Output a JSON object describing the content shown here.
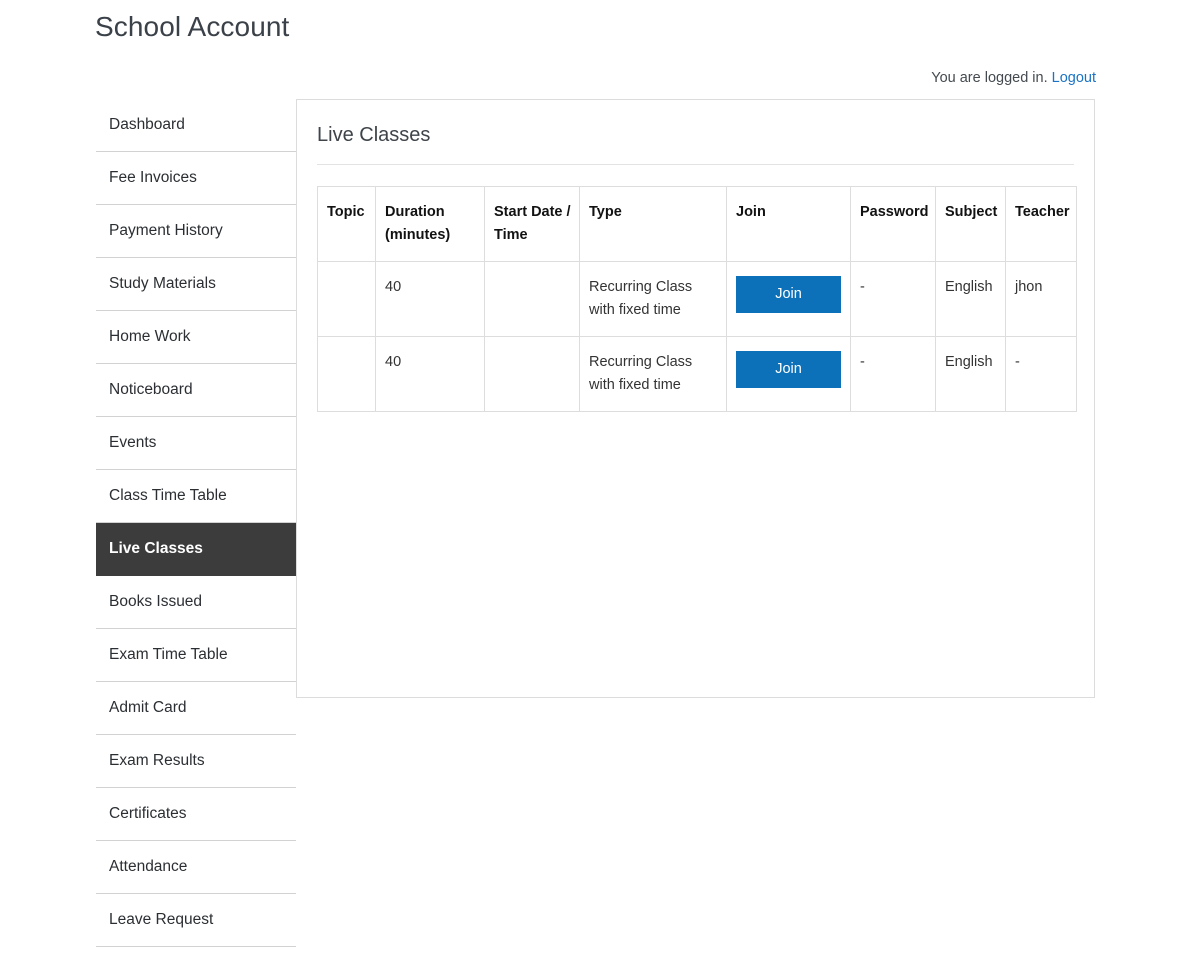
{
  "header": {
    "title": "School Account",
    "status_text": "You are logged in.",
    "logout_label": "Logout"
  },
  "sidebar": {
    "items": [
      {
        "label": "Dashboard",
        "active": false
      },
      {
        "label": "Fee Invoices",
        "active": false
      },
      {
        "label": "Payment History",
        "active": false
      },
      {
        "label": "Study Materials",
        "active": false
      },
      {
        "label": "Home Work",
        "active": false
      },
      {
        "label": "Noticeboard",
        "active": false
      },
      {
        "label": "Events",
        "active": false
      },
      {
        "label": "Class Time Table",
        "active": false
      },
      {
        "label": "Live Classes",
        "active": true
      },
      {
        "label": "Books Issued",
        "active": false
      },
      {
        "label": "Exam Time Table",
        "active": false
      },
      {
        "label": "Admit Card",
        "active": false
      },
      {
        "label": "Exam Results",
        "active": false
      },
      {
        "label": "Certificates",
        "active": false
      },
      {
        "label": "Attendance",
        "active": false
      },
      {
        "label": "Leave Request",
        "active": false
      }
    ]
  },
  "panel": {
    "heading": "Live Classes",
    "table": {
      "columns": [
        {
          "key": "topic",
          "label": "Topic"
        },
        {
          "key": "duration",
          "label": "Duration (minutes)"
        },
        {
          "key": "start",
          "label": "Start Date / Time"
        },
        {
          "key": "type",
          "label": "Type"
        },
        {
          "key": "join",
          "label": "Join"
        },
        {
          "key": "password",
          "label": "Password"
        },
        {
          "key": "subject",
          "label": "Subject"
        },
        {
          "key": "teacher",
          "label": "Teacher"
        }
      ],
      "rows": [
        {
          "topic": "",
          "duration": "40",
          "start": "",
          "type": "Recurring Class with fixed time",
          "join_label": "Join",
          "password": "-",
          "subject": "English",
          "teacher": "jhon"
        },
        {
          "topic": "",
          "duration": "40",
          "start": "",
          "type": "Recurring Class with fixed time",
          "join_label": "Join",
          "password": "-",
          "subject": "English",
          "teacher": "-"
        }
      ]
    }
  },
  "colors": {
    "accent_blue": "#0c71b8",
    "link_blue": "#1a73c4",
    "active_sidebar_bg": "#3c3c3c",
    "border_gray": "#dddddd"
  }
}
